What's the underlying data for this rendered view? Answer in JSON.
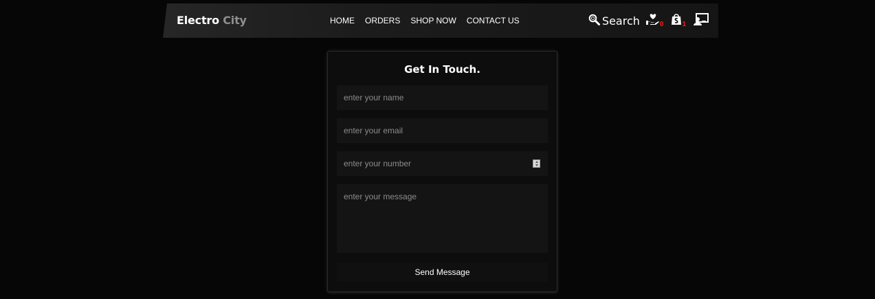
{
  "brand": {
    "part1": "Electro",
    "part2": "City"
  },
  "nav": {
    "items": [
      {
        "label": "HOME"
      },
      {
        "label": "ORDERS"
      },
      {
        "label": "SHOP NOW"
      },
      {
        "label": "CONTACT US"
      }
    ]
  },
  "actions": {
    "search_label": "Search",
    "wishlist_count": "0",
    "cart_count": "1"
  },
  "form": {
    "title": "Get In Touch.",
    "name_placeholder": "enter your name",
    "email_placeholder": "enter your email",
    "number_placeholder": "enter your number",
    "message_placeholder": "enter your message",
    "submit_label": "Send Message"
  },
  "colors": {
    "background": "#060606",
    "header": "#1c1c1c",
    "badge": "#ff1a1a",
    "brand_secondary": "#8f8f8f",
    "field": "#141414"
  },
  "icons": [
    "search-icon",
    "wishlist-icon",
    "cart-icon",
    "account-icon"
  ]
}
